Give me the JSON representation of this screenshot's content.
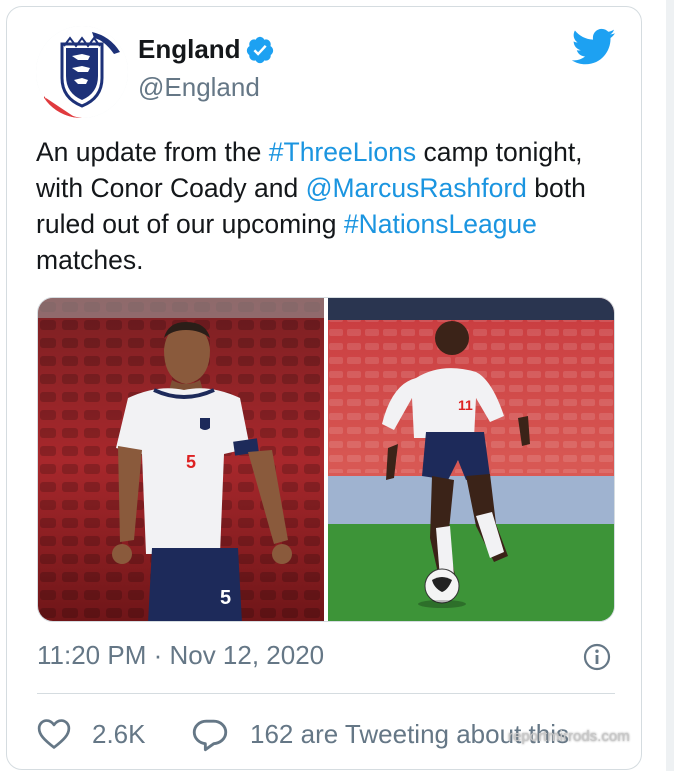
{
  "account": {
    "display_name": "England",
    "handle": "@England",
    "verified": true
  },
  "tweet": {
    "segments": [
      {
        "text": "An update from the ",
        "type": "text"
      },
      {
        "text": "#ThreeLions",
        "type": "hashtag"
      },
      {
        "text": " camp tonight, with Conor Coady and ",
        "type": "text"
      },
      {
        "text": "@MarcusRashford",
        "type": "mention"
      },
      {
        "text": " both ruled out of our upcoming ",
        "type": "text"
      },
      {
        "text": "#NationsLeague",
        "type": "hashtag"
      },
      {
        "text": " matches.",
        "type": "text"
      }
    ]
  },
  "media": {
    "left_shirt_number": "5",
    "right_shirt_number": "11"
  },
  "meta": {
    "timestamp": "11:20 PM · Nov 12, 2020"
  },
  "stats": {
    "likes": "2.6K",
    "tweeting": "162 are Tweeting about this"
  },
  "watermark": "reportmirrods.com",
  "colors": {
    "link": "#1b95e0",
    "secondary_text": "#657786",
    "border": "#d5dce0",
    "twitter_blue": "#1da1f2"
  },
  "icons": {
    "brand": "twitter-bird-icon",
    "verified": "verified-badge-icon",
    "info": "info-icon",
    "like": "heart-icon",
    "reply": "speech-bubble-icon"
  }
}
